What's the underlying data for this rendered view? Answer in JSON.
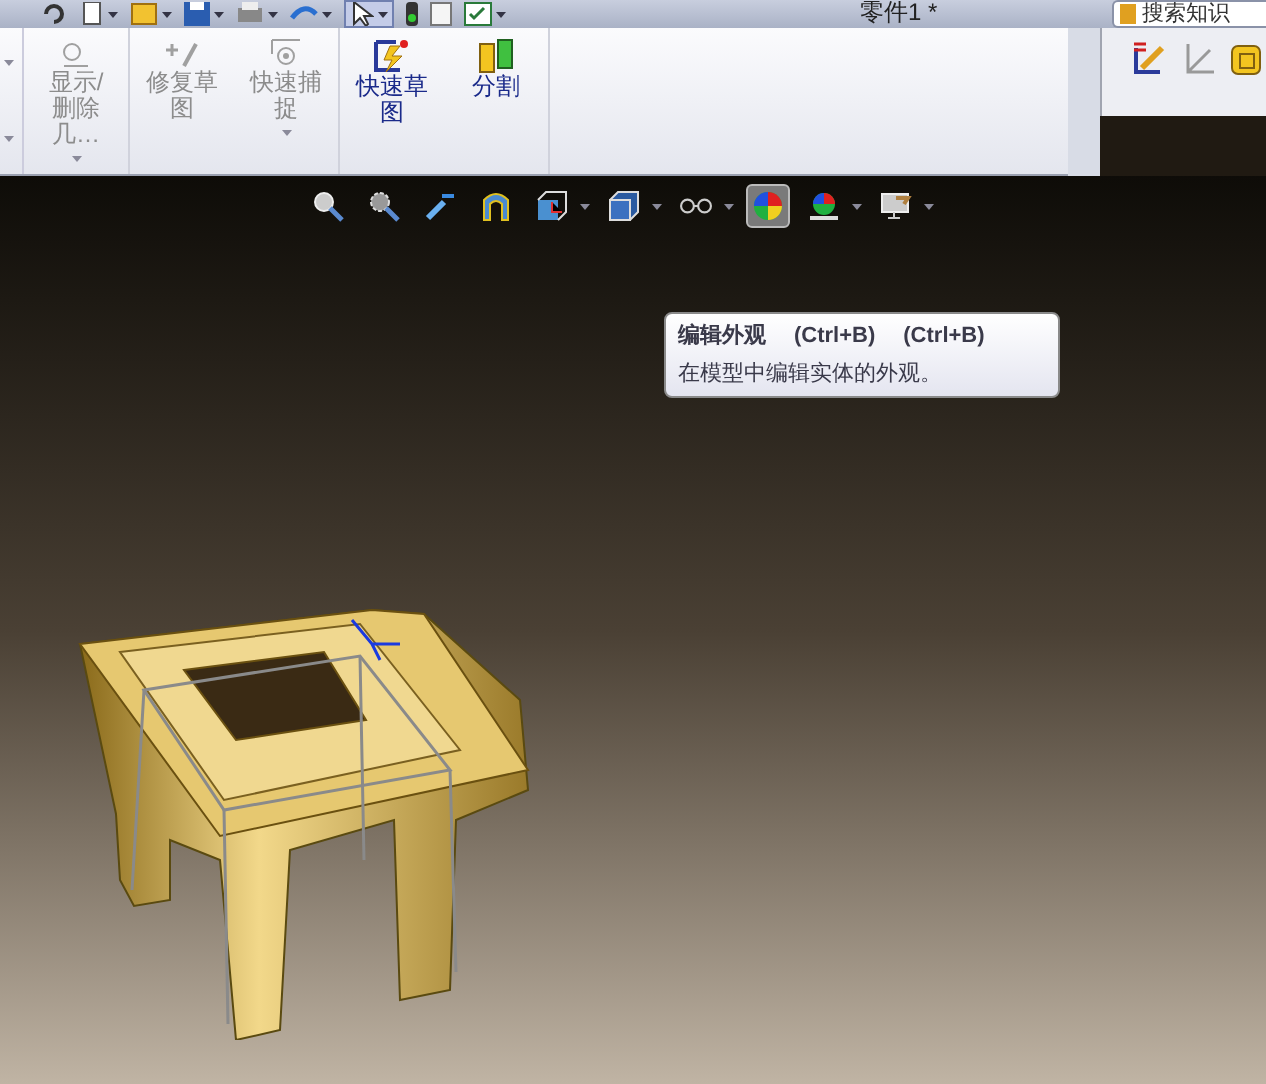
{
  "title_bar": {
    "document_title": "零件1 *",
    "search": {
      "placeholder": "搜索知识"
    }
  },
  "quick_toolbar": [
    {
      "kind": "undo",
      "dropdown": false
    },
    {
      "kind": "new",
      "dropdown": true
    },
    {
      "kind": "open",
      "dropdown": true
    },
    {
      "kind": "save",
      "dropdown": true
    },
    {
      "kind": "print",
      "dropdown": true
    },
    {
      "kind": "redo",
      "dropdown": true
    },
    {
      "kind": "select",
      "dropdown": true
    },
    {
      "kind": "light",
      "dropdown": false
    },
    {
      "kind": "file",
      "dropdown": false
    },
    {
      "kind": "options",
      "dropdown": true
    }
  ],
  "ribbon": [
    {
      "label": "显示/删除几…",
      "kind": "display",
      "disabled": true,
      "dropdown": true
    },
    {
      "label": "修复草图",
      "kind": "repair",
      "disabled": true,
      "dropdown": false
    },
    {
      "label": "快速捕捉",
      "kind": "snap",
      "disabled": true,
      "dropdown": true
    },
    {
      "label": "快速草图",
      "kind": "sketch",
      "disabled": false,
      "dropdown": false
    },
    {
      "label": "分割",
      "kind": "split",
      "disabled": false,
      "dropdown": false
    }
  ],
  "task_icons": [
    {
      "kind": "sketch3d"
    },
    {
      "kind": "angle"
    },
    {
      "kind": "box"
    }
  ],
  "view_toolbar": [
    {
      "kind": "zoom-fit",
      "selected": false,
      "dropdown": false
    },
    {
      "kind": "zoom-area",
      "selected": false,
      "dropdown": false
    },
    {
      "kind": "previous",
      "selected": false,
      "dropdown": false
    },
    {
      "kind": "section",
      "selected": false,
      "dropdown": false
    },
    {
      "kind": "orientation",
      "selected": false,
      "dropdown": true
    },
    {
      "kind": "display-style",
      "selected": false,
      "dropdown": true
    },
    {
      "kind": "hide-show",
      "selected": false,
      "dropdown": true
    },
    {
      "kind": "appearance",
      "selected": true,
      "dropdown": false
    },
    {
      "kind": "scene",
      "selected": false,
      "dropdown": true
    },
    {
      "kind": "view-settings",
      "selected": false,
      "dropdown": true
    }
  ],
  "tooltip": {
    "title": "编辑外观",
    "shortcuts": [
      "(Ctrl+B)",
      "(Ctrl+B)"
    ],
    "description": "在模型中编辑实体的外观。"
  }
}
